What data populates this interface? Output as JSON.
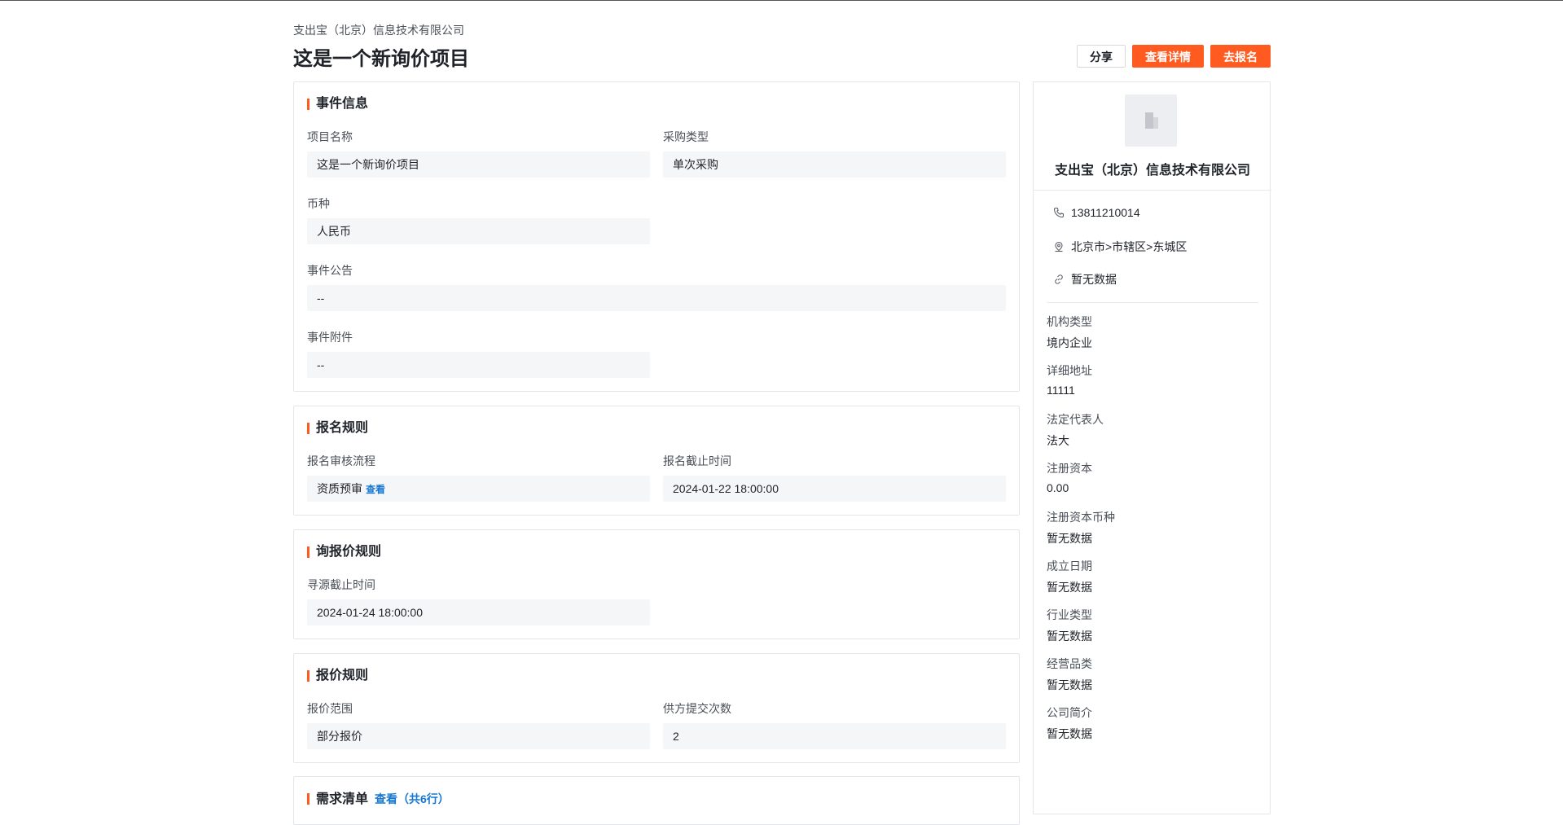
{
  "header": {
    "company": "支出宝（北京）信息技术有限公司",
    "title": "这是一个新询价项目",
    "share_label": "分享",
    "detail_label": "查看详情",
    "signup_label": "去报名"
  },
  "event_info": {
    "title": "事件信息",
    "project_name_label": "项目名称",
    "project_name_value": "这是一个新询价项目",
    "purchase_type_label": "采购类型",
    "purchase_type_value": "单次采购",
    "currency_label": "币种",
    "currency_value": "人民币",
    "announcement_label": "事件公告",
    "announcement_value": "--",
    "attachment_label": "事件附件",
    "attachment_value": "--"
  },
  "signup_rules": {
    "title": "报名规则",
    "review_label": "报名审核流程",
    "review_value": "资质预审",
    "review_link": "查看",
    "deadline_label": "报名截止时间",
    "deadline_value": "2024-01-22 18:00:00"
  },
  "inquiry_rules": {
    "title": "询报价规则",
    "sourcing_deadline_label": "寻源截止时间",
    "sourcing_deadline_value": "2024-01-24 18:00:00"
  },
  "quote_rules": {
    "title": "报价规则",
    "scope_label": "报价范围",
    "scope_value": "部分报价",
    "submit_count_label": "供方提交次数",
    "submit_count_value": "2"
  },
  "demand_list": {
    "title": "需求清单",
    "link": "查看（共6行）"
  },
  "sidebar": {
    "company": "支出宝（北京）信息技术有限公司",
    "phone": "13811210014",
    "region": "北京市>市辖区>东城区",
    "website": "暂无数据",
    "fields": [
      {
        "label": "机构类型",
        "value": "境内企业"
      },
      {
        "label": "详细地址",
        "value": "11111"
      },
      {
        "label": "法定代表人",
        "value": "法大"
      },
      {
        "label": "注册资本",
        "value": "0.00"
      },
      {
        "label": "注册资本币种",
        "value": "暂无数据"
      },
      {
        "label": "成立日期",
        "value": "暂无数据"
      },
      {
        "label": "行业类型",
        "value": "暂无数据"
      },
      {
        "label": "经营品类",
        "value": "暂无数据"
      },
      {
        "label": "公司简介",
        "value": "暂无数据"
      }
    ]
  },
  "colors": {
    "accent": "#ff5a1f",
    "link": "#1677d2"
  }
}
